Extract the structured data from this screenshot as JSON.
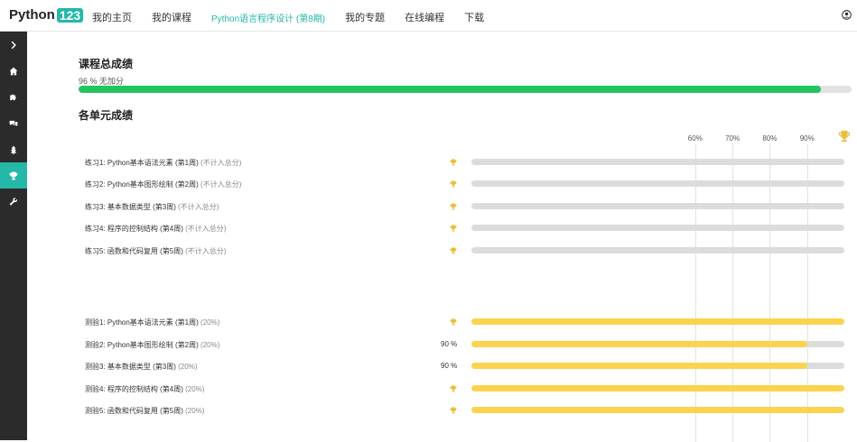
{
  "brand": {
    "name": "Python",
    "num": "123"
  },
  "nav": [
    {
      "label": "我的主页",
      "active": false
    },
    {
      "label": "我的课程",
      "active": false
    },
    {
      "label": "Python语言程序设计 (第8期)",
      "active": true
    },
    {
      "label": "我的专题",
      "active": false
    },
    {
      "label": "在线编程",
      "active": false
    },
    {
      "label": "下载",
      "active": false
    }
  ],
  "sidebar": [
    {
      "icon": "chevron-right-icon",
      "active": false
    },
    {
      "icon": "home-icon",
      "active": false
    },
    {
      "icon": "puzzle-icon",
      "active": false
    },
    {
      "icon": "comments-icon",
      "active": false
    },
    {
      "icon": "tree-icon",
      "active": false
    },
    {
      "icon": "trophy-icon",
      "active": true
    },
    {
      "icon": "wrench-icon",
      "active": false
    }
  ],
  "overall": {
    "title": "课程总成绩",
    "text": "96 % 无加分",
    "value": 0.96,
    "color": "#22c55e"
  },
  "units_title": "各单元成绩",
  "scale": [
    "60%",
    "70%",
    "80%",
    "90%"
  ],
  "units": [
    {
      "name": "练习1: Python基本语法元素 (第1周)",
      "note": "(不计入总分)",
      "score": "",
      "trophy": true,
      "value": 0
    },
    {
      "name": "练习2: Python基本图形绘制 (第2周)",
      "note": "(不计入总分)",
      "score": "",
      "trophy": true,
      "value": 0
    },
    {
      "name": "练习3: 基本数据类型 (第3周)",
      "note": "(不计入总分)",
      "score": "",
      "trophy": true,
      "value": 0
    },
    {
      "name": "练习4: 程序的控制结构 (第4周)",
      "note": "(不计入总分)",
      "score": "",
      "trophy": true,
      "value": 0
    },
    {
      "name": "练习5: 函数和代码复用 (第5周)",
      "note": "(不计入总分)",
      "score": "",
      "trophy": true,
      "value": 0
    },
    {
      "name": "测验1: Python基本语法元素 (第1周)",
      "note": "(20%)",
      "score": "",
      "trophy": true,
      "value": 1.0
    },
    {
      "name": "测验2: Python基本图形绘制 (第2周)",
      "note": "(20%)",
      "score": "90 %",
      "trophy": false,
      "value": 0.9
    },
    {
      "name": "测验3: 基本数据类型 (第3周)",
      "note": "(20%)",
      "score": "90 %",
      "trophy": false,
      "value": 0.9
    },
    {
      "name": "测验4: 程序的控制结构 (第4周)",
      "note": "(20%)",
      "score": "",
      "trophy": true,
      "value": 1.0
    },
    {
      "name": "测验5: 函数和代码复用 (第5周)",
      "note": "(20%)",
      "score": "",
      "trophy": true,
      "value": 1.0
    }
  ],
  "colors": {
    "accent": "#25b7a8",
    "bar_fill": "#fcd34d",
    "bar_bg": "#dcdcdc",
    "trophy": "#e8c040",
    "sidebar": "#2b2b2b"
  }
}
